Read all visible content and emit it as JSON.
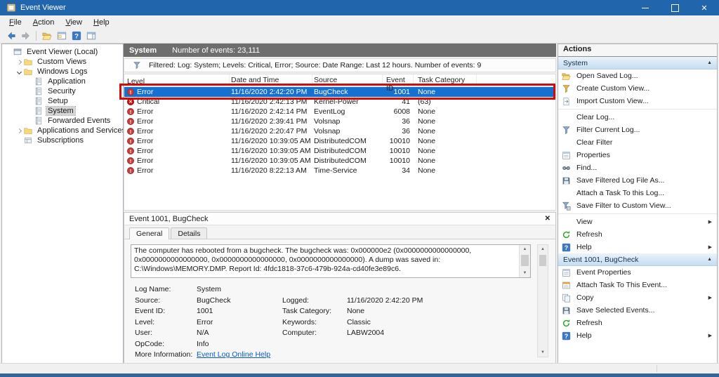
{
  "window": {
    "title": "Event Viewer"
  },
  "menu": [
    "File",
    "Action",
    "View",
    "Help"
  ],
  "toolbar": {
    "buttons": [
      "back",
      "forward",
      "show-console-tree",
      "console-window",
      "help",
      "action-pane"
    ]
  },
  "tree": {
    "root": "Event Viewer (Local)",
    "items": [
      {
        "label": "Custom Views",
        "indent": 1,
        "expander": ">",
        "icon": "folder"
      },
      {
        "label": "Windows Logs",
        "indent": 1,
        "expander": "v",
        "icon": "folder"
      },
      {
        "label": "Application",
        "indent": 2,
        "expander": "",
        "icon": "log"
      },
      {
        "label": "Security",
        "indent": 2,
        "expander": "",
        "icon": "log"
      },
      {
        "label": "Setup",
        "indent": 2,
        "expander": "",
        "icon": "log"
      },
      {
        "label": "System",
        "indent": 2,
        "expander": "",
        "icon": "log",
        "selected": true
      },
      {
        "label": "Forwarded Events",
        "indent": 2,
        "expander": "",
        "icon": "log"
      },
      {
        "label": "Applications and Services Logs",
        "indent": 1,
        "expander": ">",
        "icon": "folder"
      },
      {
        "label": "Subscriptions",
        "indent": 1,
        "expander": "",
        "icon": "subscription"
      }
    ]
  },
  "main": {
    "header": {
      "log_name": "System",
      "events_count": "Number of events: 23,111"
    },
    "filter_text": "Filtered: Log: System; Levels: Critical, Error; Source: Date Range: Last 12 hours. Number of events: 9",
    "columns": [
      "Level",
      "Date and Time",
      "Source",
      "Event ID",
      "Task Category"
    ],
    "rows": [
      {
        "level": "Error",
        "datetime": "11/16/2020 2:42:20 PM",
        "source": "BugCheck",
        "event_id": "1001",
        "task_category": "None",
        "selected": true
      },
      {
        "level": "Critical",
        "datetime": "11/16/2020 2:42:13 PM",
        "source": "Kernel-Power",
        "event_id": "41",
        "task_category": "(63)"
      },
      {
        "level": "Error",
        "datetime": "11/16/2020 2:42:14 PM",
        "source": "EventLog",
        "event_id": "6008",
        "task_category": "None"
      },
      {
        "level": "Error",
        "datetime": "11/16/2020 2:39:41 PM",
        "source": "Volsnap",
        "event_id": "36",
        "task_category": "None"
      },
      {
        "level": "Error",
        "datetime": "11/16/2020 2:20:47 PM",
        "source": "Volsnap",
        "event_id": "36",
        "task_category": "None"
      },
      {
        "level": "Error",
        "datetime": "11/16/2020 10:39:05 AM",
        "source": "DistributedCOM",
        "event_id": "10010",
        "task_category": "None"
      },
      {
        "level": "Error",
        "datetime": "11/16/2020 10:39:05 AM",
        "source": "DistributedCOM",
        "event_id": "10010",
        "task_category": "None"
      },
      {
        "level": "Error",
        "datetime": "11/16/2020 10:39:05 AM",
        "source": "DistributedCOM",
        "event_id": "10010",
        "task_category": "None"
      },
      {
        "level": "Error",
        "datetime": "11/16/2020 8:22:13 AM",
        "source": "Time-Service",
        "event_id": "34",
        "task_category": "None"
      }
    ]
  },
  "detail": {
    "title": "Event 1001, BugCheck",
    "tabs": [
      "General",
      "Details"
    ],
    "message": "The computer has rebooted from a bugcheck.  The bugcheck was: 0x000000e2 (0x0000000000000000, 0x0000000000000000, 0x0000000000000000, 0x0000000000000000). A dump was saved in: C:\\Windows\\MEMORY.DMP. Report Id: 4fdc1818-37c6-479b-924a-cd40fe3e89c6.",
    "fields": [
      {
        "label": "Log Name:",
        "value": "System"
      },
      {
        "label": "Source:",
        "value": "BugCheck",
        "label2": "Logged:",
        "value2": "11/16/2020 2:42:20 PM"
      },
      {
        "label": "Event ID:",
        "value": "1001",
        "label2": "Task Category:",
        "value2": "None"
      },
      {
        "label": "Level:",
        "value": "Error",
        "label2": "Keywords:",
        "value2": "Classic"
      },
      {
        "label": "User:",
        "value": "N/A",
        "label2": "Computer:",
        "value2": "LABW2004"
      },
      {
        "label": "OpCode:",
        "value": "Info"
      },
      {
        "label": "More Information:",
        "value": "Event Log Online Help",
        "link": true
      }
    ]
  },
  "actions": {
    "title": "Actions",
    "sections": [
      {
        "title": "System",
        "items": [
          {
            "label": "Open Saved Log...",
            "icon": "open-folder"
          },
          {
            "label": "Create Custom View...",
            "icon": "funnel-create"
          },
          {
            "label": "Import Custom View...",
            "icon": "import"
          },
          {
            "separator": true
          },
          {
            "label": "Clear Log...",
            "icon": "none"
          },
          {
            "label": "Filter Current Log...",
            "icon": "funnel"
          },
          {
            "label": "Clear Filter",
            "icon": "none"
          },
          {
            "label": "Properties",
            "icon": "properties"
          },
          {
            "label": "Find...",
            "icon": "find"
          },
          {
            "label": "Save Filtered Log File As...",
            "icon": "save"
          },
          {
            "label": "Attach a Task To this Log...",
            "icon": "none"
          },
          {
            "label": "Save Filter to Custom View...",
            "icon": "funnel-save"
          },
          {
            "separator": true
          },
          {
            "label": "View",
            "icon": "none",
            "submenu": true
          },
          {
            "label": "Refresh",
            "icon": "refresh"
          },
          {
            "label": "Help",
            "icon": "help",
            "submenu": true
          }
        ]
      },
      {
        "title": "Event 1001, BugCheck",
        "items": [
          {
            "label": "Event Properties",
            "icon": "properties"
          },
          {
            "label": "Attach Task To This Event...",
            "icon": "task"
          },
          {
            "label": "Copy",
            "icon": "copy",
            "submenu": true
          },
          {
            "label": "Save Selected Events...",
            "icon": "save"
          },
          {
            "label": "Refresh",
            "icon": "refresh"
          },
          {
            "label": "Help",
            "icon": "help",
            "submenu": true
          }
        ]
      }
    ]
  },
  "colors": {
    "titlebar_blue": "#2166ac",
    "selection_blue": "#1670d0",
    "annotation_red": "#cf0d0d",
    "panel_header_gray": "#6e6e6e",
    "section_header_blue_top": "#e9f3fb",
    "section_header_blue_bottom": "#c6ddf2",
    "link_blue": "#0a58c4",
    "error_red": "#c83c3c",
    "critical_red": "#cc1414",
    "bottom_stripe_blue": "#35639b"
  }
}
